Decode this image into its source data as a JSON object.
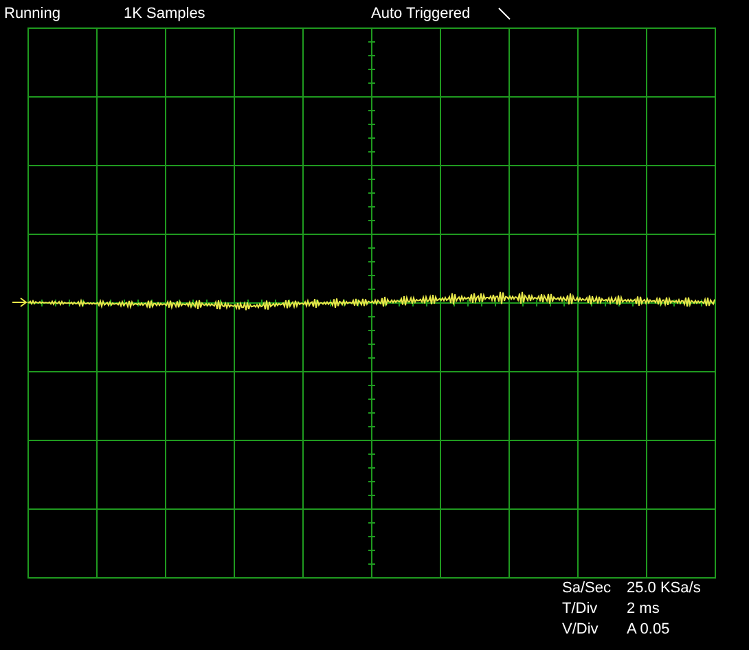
{
  "status_bar": {
    "run_state": "Running",
    "samples": "1K Samples",
    "trigger": "Auto Triggered"
  },
  "readouts": [
    {
      "label": "Sa/Sec",
      "value": "25.0 KSa/s"
    },
    {
      "label": "T/Div",
      "value": "2 ms"
    },
    {
      "label": "V/Div",
      "value": "A 0.05"
    }
  ]
}
